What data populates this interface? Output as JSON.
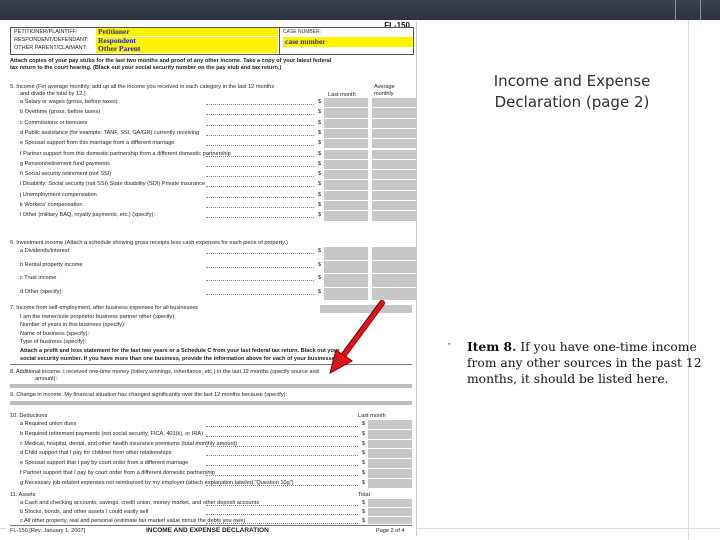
{
  "slide": {
    "title": "Income and Expense Declaration (page 2)",
    "bullet_lead": "Item 8.",
    "bullet_body": "If you have one-time income from any other sources in the past 12 months, it should be listed here."
  },
  "form": {
    "form_number": "FL-150",
    "header": {
      "party_labels": [
        "PETITIONER/PLAINTIFF:",
        "RESPONDENT/DEFENDANT:",
        "OTHER PARENT/CLAIMANT:"
      ],
      "party_values": [
        "Petitioner",
        "Respondent",
        "Other Parent"
      ],
      "case_label": "CASE NUMBER:",
      "case_value": "case number"
    },
    "attach_note": "Attach copies of your pay stubs for the last two months and proof of any other income. Take a copy of your latest federal",
    "attach_note2": "tax return to the court hearing. (Black out your social security number on the pay stub and tax return.)",
    "item5": {
      "heading": "5.   Income (For average monthly, add up all the income you received in each category in the last 12 months",
      "heading2": "and divide the total by 12.)",
      "col1": "Last month",
      "col2": "Average monthly",
      "rows": [
        "a  Salary or wages (gross, before taxes)",
        "b  Overtime (gross, before taxes)",
        "c  Commissions or bonuses",
        "d  Public assistance (for example: TANF, SSI, GA/GR)    currently receiving",
        "e  Spousal support      from this marriage      from a different marriage",
        "f  Partner support      from this domestic partnership      from a different domestic partnership",
        "g  Pension/retirement fund payments",
        "h  Social security retirement (not SSI)",
        "i  Disability:     Social security (not SSI)     State disability (SDI)     Private insurance",
        "j  Unemployment compensation",
        "k  Workers' compensation",
        "l  Other (military BAQ, royalty payments, etc.) (specify):"
      ]
    },
    "item6": {
      "heading": "6.   Investment income (Attach a schedule showing gross receipts less cash expenses for each piece of property.)",
      "rows": [
        "a  Dividends/interest",
        "b  Rental property income",
        "c  Trust income",
        "d  Other (specify):"
      ]
    },
    "item7": {
      "heading": "7.   Income from self-employment, after business expenses for all businesses",
      "lines": [
        "I am the      owner/sole proprietor      business partner      other (specify):",
        "Number of years in this business (specify):",
        "Name of business (specify):",
        "Type of business (specify):",
        "Attach a profit and loss statement for the last two years or a Schedule C from your last federal tax return. Black out your",
        "social security number. If you have more than one business, provide the information above for each of your businesses."
      ]
    },
    "item8": "8.   Additional income. I received one-time money (lottery winnings, inheritance, etc.) in the last 12 months (specify source and",
    "item8b": "amount):",
    "item9": "9.   Change in income. My financial situation has changed significantly over the last 12 months because (specify):",
    "item10": {
      "heading": "10.  Deductions",
      "col": "Last month",
      "rows": [
        "a  Required union dues",
        "b  Required retirement payments (not social security, FICA, 401(k), or IRA)",
        "c  Medical, hospital, dental, and other health insurance premiums (total monthly amount)",
        "d  Child support that I pay for children from other relationships",
        "e  Spousal support that I pay by court order from a different marriage",
        "f  Partner support that I pay by court order from a different domestic partnership",
        "g  Necessary job-related expenses not reimbursed by my employer (attach explanation labeled \"Question 10g\")"
      ]
    },
    "item11": {
      "heading": "11.  Assets",
      "col": "Total",
      "rows": [
        "a  Cash and checking accounts, savings, credit union, money market, and other deposit accounts",
        "b  Stocks, bonds, and other assets I could easily sell",
        "c  All other property,      real and      personal (estimate fair market value minus the debts you owe)"
      ]
    },
    "footer_left": "FL-150 [Rev. January 1, 2007]",
    "footer_center": "INCOME AND EXPENSE DECLARATION",
    "footer_right": "Page 2 of 4",
    "dollar": "$"
  },
  "colors": {
    "highlight_yellow": "#fff200",
    "highlight_text": "#1c2bb0",
    "arrow": "#e0141a",
    "topbar": "#2c323e"
  }
}
